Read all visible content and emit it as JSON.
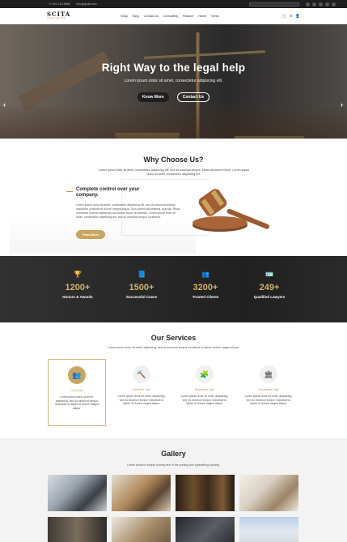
{
  "topbar": {
    "phone": "+1 022 123 4568",
    "email": "info@gmail.com"
  },
  "header": {
    "logo": "SCITA",
    "tagline": "Legal & Law Firm",
    "nav": [
      "Shop",
      "Blog",
      "Contact us",
      "Consulting",
      "Finance",
      "Home",
      "Items"
    ],
    "cart_count": "0"
  },
  "hero": {
    "title": "Right Way to the legal help",
    "subtitle": "Lorem ipsum dolor sit amet, consectetur adipiscing elit.",
    "primary_button": "Know More",
    "secondary_button": "Contact Us",
    "prev_arrow": "‹",
    "next_arrow": "›"
  },
  "why": {
    "title": "Why Choose Us?",
    "lead": "Lorem ipsum dolor sit amet, consectetur adipiscing elit, sed do eiusmod tempor. Etiam all dolore mirum. Lorem ipsum dolor sit amet, consectetur adipiscing elit.",
    "heading": "Complete control over your company.",
    "body": "Lorem ipsum dolor sit amet, consectetur adipiscing elit, sed do eiusmod tempor incididunt ut labore et dolore magna aliqua. Duis autem accusamus, gravida. Risus commodo viverra maecenas accumsan lacus vel facilisis. Lorem ipsum dolor sit amet, consectetur adipiscing elit, sed do eiusmod tempor incididunt.",
    "button": "Read More"
  },
  "stats": [
    {
      "icon": "trophy-icon",
      "glyph": "🏆",
      "value": "1200+",
      "label": "Honors & Awards"
    },
    {
      "icon": "book-icon",
      "glyph": "📘",
      "value": "1500+",
      "label": "Successful Cases"
    },
    {
      "icon": "users-icon",
      "glyph": "👥",
      "value": "3200+",
      "label": "Trusted Clients"
    },
    {
      "icon": "lawyer-icon",
      "glyph": "🪪",
      "value": "249+",
      "label": "Qualified Lawyers"
    }
  ],
  "services": {
    "title": "Our Services",
    "lead": "Lorem ipsum dolor sit amet, adipiscing, sed do eiusmod tempor incididunt ut labore dolore magna aliqua.",
    "items": [
      {
        "icon": "people-icon",
        "glyph": "👥",
        "name": "Civil Law",
        "desc": "Lorem ipsum dolor sit amet, adipiscing, sed do eiusmod tempor incididunt ut labore et dolore magna aliqua.",
        "active": true
      },
      {
        "icon": "gavel-icon",
        "glyph": "🔨",
        "name": "Criminal Law",
        "desc": "Lorem ipsum dolor sit amet, adipiscing, sed do eiusmod tempor incididunt ut labore et dolore magna aliqua."
      },
      {
        "icon": "puzzle-icon",
        "glyph": "🧩",
        "name": "Business Law",
        "desc": "Lorem ipsum dolor sit amet, adipiscing, sed do eiusmod tempor incididunt ut labore et dolore magna aliqua."
      },
      {
        "icon": "courthouse-icon",
        "glyph": "🏛",
        "name": "Corporate Law",
        "desc": "Lorem ipsum dolor sit amet, adipiscing, sed do eiusmod tempor incididunt ut labore et dolore magna aliqua."
      }
    ]
  },
  "gallery": {
    "title": "Gallery",
    "lead": "Lorem Ipsum is simply dummy text of the printing and typesetting industry."
  },
  "colors": {
    "accent": "#c9a55f",
    "dark": "#1e1e1e"
  }
}
